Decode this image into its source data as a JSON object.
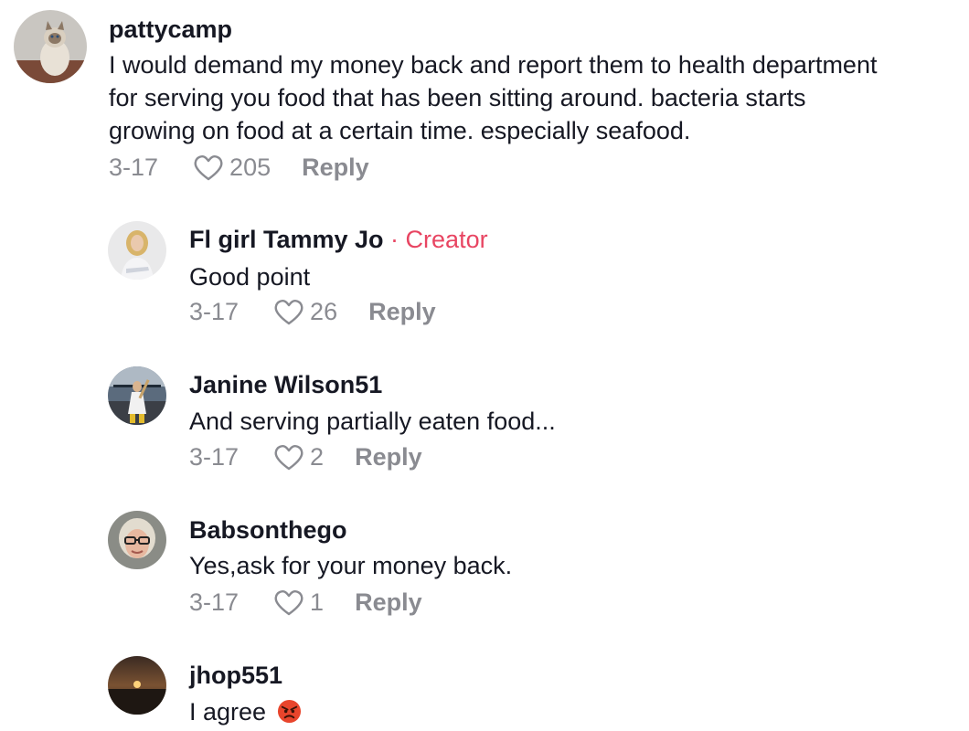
{
  "comments": [
    {
      "username": "pattycamp",
      "text_lines": [
        "I would demand my money back and report them to health department",
        "for serving you food that has been sitting around. bacteria starts",
        "growing on food at a certain time. especially seafood."
      ],
      "date": "3-17",
      "likes": "205",
      "reply_label": "Reply"
    },
    {
      "username": "Fl girl Tammy Jo",
      "creator_tag": " · Creator",
      "text": "Good point",
      "date": "3-17",
      "likes": "26",
      "reply_label": "Reply"
    },
    {
      "username": "Janine Wilson51",
      "text": "And serving partially eaten food...",
      "date": "3-17",
      "likes": "2",
      "reply_label": "Reply"
    },
    {
      "username": "Babsonthego",
      "text": "Yes,ask for your money back.",
      "date": "3-17",
      "likes": "1",
      "reply_label": "Reply"
    },
    {
      "username": "jhop551",
      "text": "I agree",
      "emoji": "angry-face"
    }
  ],
  "colors": {
    "text": "#161823",
    "secondary": "#8a8b91",
    "creator": "#e84562"
  }
}
